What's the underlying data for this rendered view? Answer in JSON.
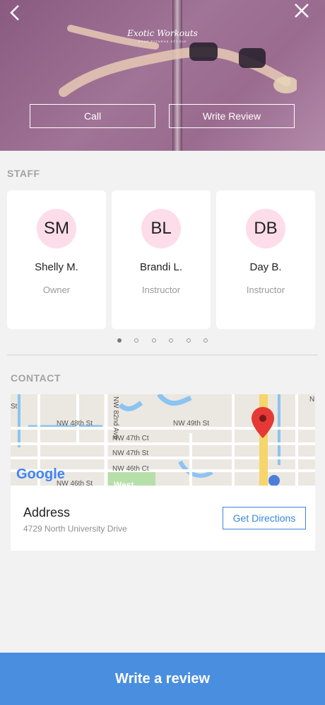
{
  "hero": {
    "logo_text": "Exotic Workouts",
    "logo_sub": "POLE FITNESS STUDIO",
    "call_label": "Call",
    "write_review_label": "Write Review",
    "back_icon": "chevron-left-icon",
    "close_icon": "close-icon"
  },
  "staff": {
    "title": "STAFF",
    "members": [
      {
        "initials": "SM",
        "name": "Shelly M.",
        "role": "Owner"
      },
      {
        "initials": "BL",
        "name": "Brandi L.",
        "role": "Instructor"
      },
      {
        "initials": "DB",
        "name": "Day B.",
        "role": "Instructor"
      }
    ],
    "page_count": 6,
    "active_page": 1
  },
  "contact": {
    "title": "CONTACT",
    "map": {
      "streets": [
        "NW 48th St",
        "NW 49th St",
        "NW 47th Ct",
        "NW 47th St",
        "NW 46th Ct",
        "NW 46th St",
        "NW 82nd Ave",
        "St",
        "N",
        "West"
      ],
      "provider": "Google"
    },
    "address_label": "Address",
    "address_value": "4729 North University Drive",
    "directions_label": "Get Directions"
  },
  "footer": {
    "write_review_label": "Write a review"
  },
  "colors": {
    "accent": "#4a8ee0",
    "avatar_bg": "#fcdde9",
    "hero_tint": "#9a6b8f",
    "pin": "#e53935"
  }
}
